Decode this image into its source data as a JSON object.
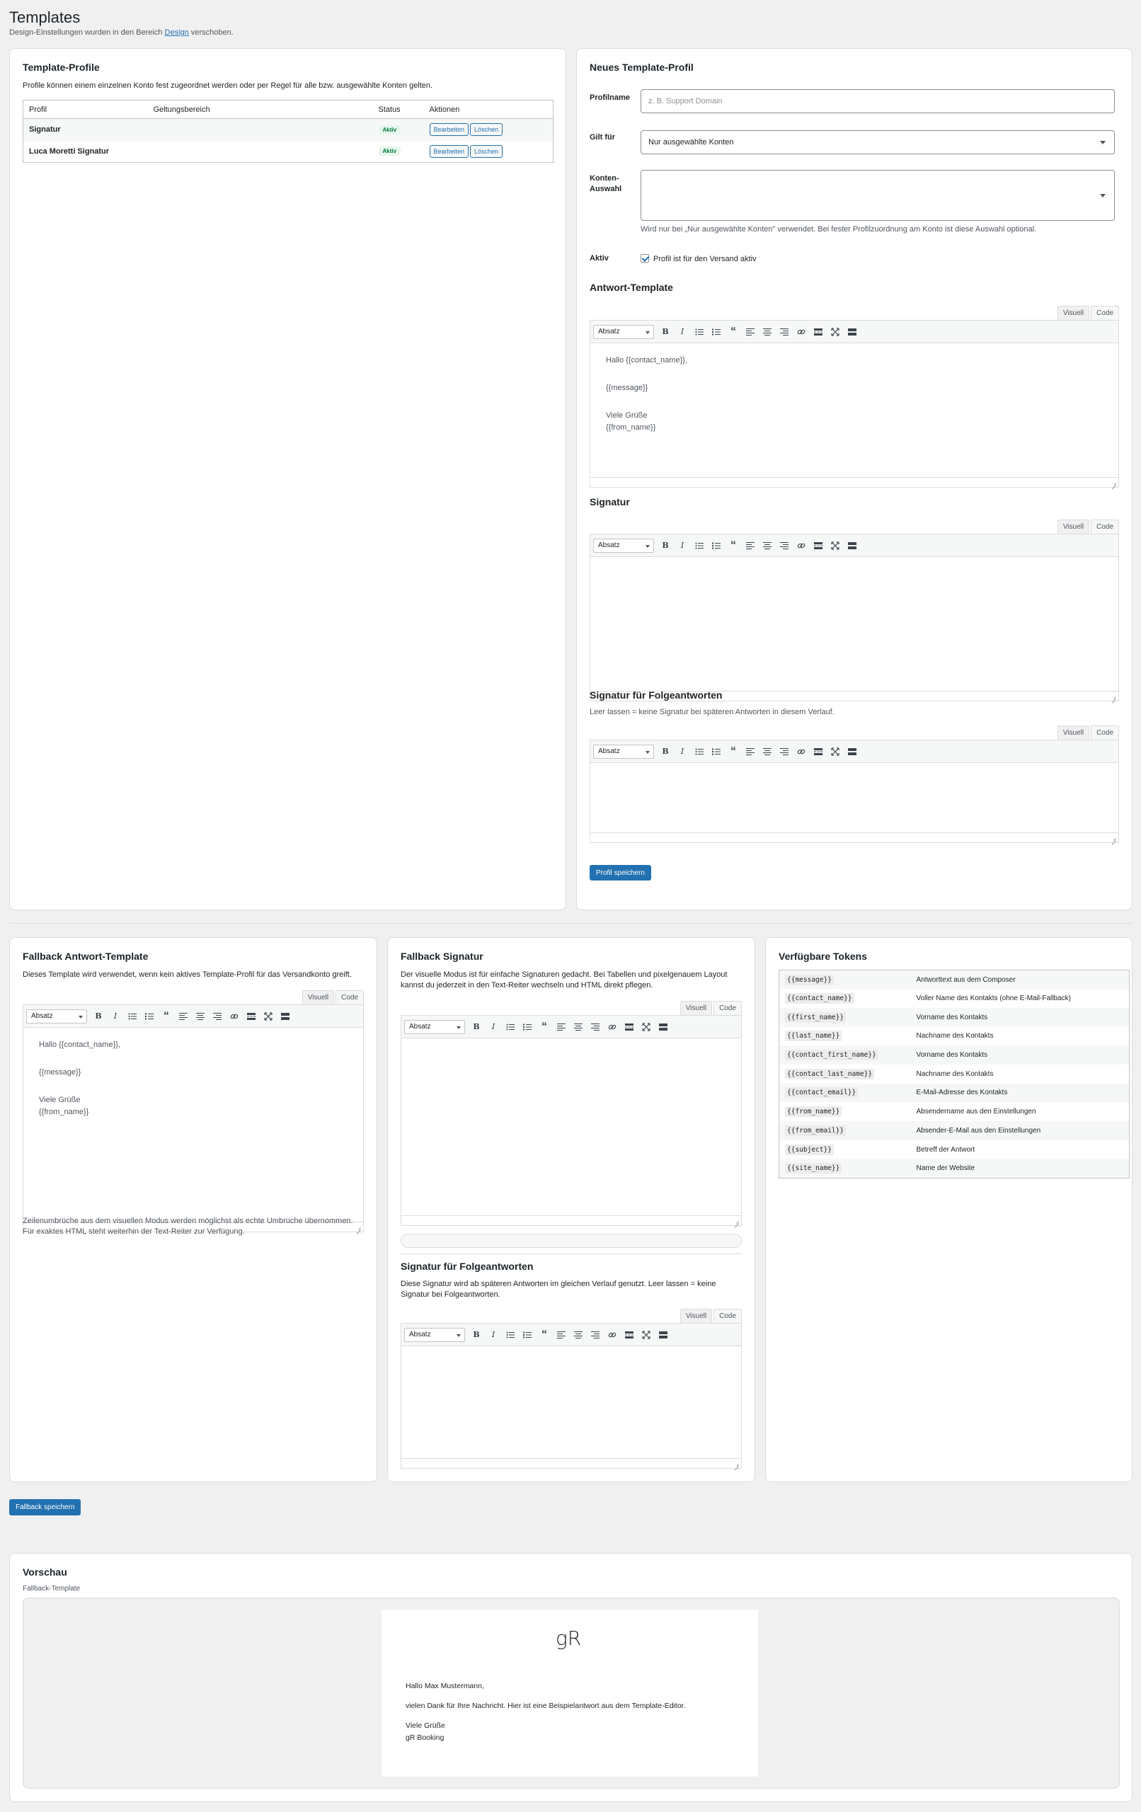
{
  "page": {
    "title": "Templates",
    "notice_before": "Design-Einstellungen wurden in den Bereich ",
    "notice_link": "Design",
    "notice_after": " verschoben."
  },
  "profiles": {
    "title": "Template-Profile",
    "description": "Profile können einem einzelnen Konto fest zugeordnet werden oder per Regel für alle bzw. ausgewählte Konten gelten.",
    "columns": [
      "Profil",
      "Geltungsbereich",
      "Status",
      "Aktionen"
    ],
    "rows": [
      {
        "name": "Signatur",
        "scope": "",
        "status": "Aktiv",
        "edit": "Bearbeiten",
        "delete": "Löschen"
      },
      {
        "name": "Luca Moretti Signatur",
        "scope": "",
        "status": "Aktiv",
        "edit": "Bearbeiten",
        "delete": "Löschen"
      }
    ]
  },
  "new_profile": {
    "title": "Neues Template-Profil",
    "name_label": "Profilname",
    "name_placeholder": "z. B. Support Domain",
    "applies_label": "Gilt für",
    "applies_value": "Nur ausgewählte Konten",
    "accounts_label_1": "Konten-",
    "accounts_label_2": "Auswahl",
    "accounts_help": "Wird nur bei „Nur ausgewählte Konten\" verwendet. Bei fester Profilzuordnung am Konto ist diese Auswahl optional.",
    "active_label": "Aktiv",
    "active_checkbox": "Profil ist für den Versand aktiv",
    "reply_title": "Antwort-Template",
    "signature_title": "Signatur",
    "followup_title": "Signatur für Folgeantworten",
    "followup_help": "Leer lassen = keine Signatur bei späteren Antworten in diesem Verlauf.",
    "save_button": "Profil speichern"
  },
  "editor": {
    "tab_visual": "Visuell",
    "tab_code": "Code",
    "format": "Absatz",
    "template_greeting": "Hallo {{contact_name}},",
    "template_message": "{{message}}",
    "template_regards": "Viele Grüße",
    "template_from": "{{from_name}}"
  },
  "fallback_reply": {
    "title": "Fallback Antwort-Template",
    "description": "Dieses Template wird verwendet, wenn kein aktives Template-Profil für das Versandkonto greift.",
    "help": "Zeilenumbrüche aus dem visuellen Modus werden möglichst als echte Umbrüche übernommen. Für exaktes HTML steht weiterhin der Text-Reiter zur Verfügung."
  },
  "fallback_signature": {
    "title": "Fallback Signatur",
    "description": "Der visuelle Modus ist für einfache Signaturen gedacht. Bei Tabellen und pixelgenauem Layout kannst du jederzeit in den Text-Reiter wechseln und HTML direkt pflegen.",
    "followup_title": "Signatur für Folgeantworten",
    "followup_help": "Diese Signatur wird ab späteren Antworten im gleichen Verlauf genutzt. Leer lassen = keine Signatur bei Folgeantworten."
  },
  "tokens": {
    "title": "Verfügbare Tokens",
    "rows": [
      {
        "token": "{{message}}",
        "desc": "Antworttext aus dem Composer"
      },
      {
        "token": "{{contact_name}}",
        "desc": "Voller Name des Kontakts (ohne E-Mail-Fallback)"
      },
      {
        "token": "{{first_name}}",
        "desc": "Vorname des Kontakts"
      },
      {
        "token": "{{last_name}}",
        "desc": "Nachname des Kontakts"
      },
      {
        "token": "{{contact_first_name}}",
        "desc": "Vorname des Kontakts"
      },
      {
        "token": "{{contact_last_name}}",
        "desc": "Nachname des Kontakts"
      },
      {
        "token": "{{contact_email}}",
        "desc": "E-Mail-Adresse des Kontakts"
      },
      {
        "token": "{{from_name}}",
        "desc": "Absendername aus den Einstellungen"
      },
      {
        "token": "{{from_email}}",
        "desc": "Absender-E-Mail aus den Einstellungen"
      },
      {
        "token": "{{subject}}",
        "desc": "Betreff der Antwort"
      },
      {
        "token": "{{site_name}}",
        "desc": "Name der Website"
      }
    ]
  },
  "fallback_save": "Fallback speichern",
  "preview": {
    "title": "Vorschau",
    "subtitle": "Fallback-Template",
    "logo_text": "gR",
    "greeting": "Hallo Max Mustermann,",
    "body": "vielen Dank für Ihre Nachricht. Hier ist eine Beispielantwort aus dem Template-Editor.",
    "regards": "Viele Grüße",
    "sender": "gR Booking"
  },
  "colors": {
    "primary": "#2271b1",
    "background": "#f0f0f1",
    "active_badge": "#007a3d"
  }
}
